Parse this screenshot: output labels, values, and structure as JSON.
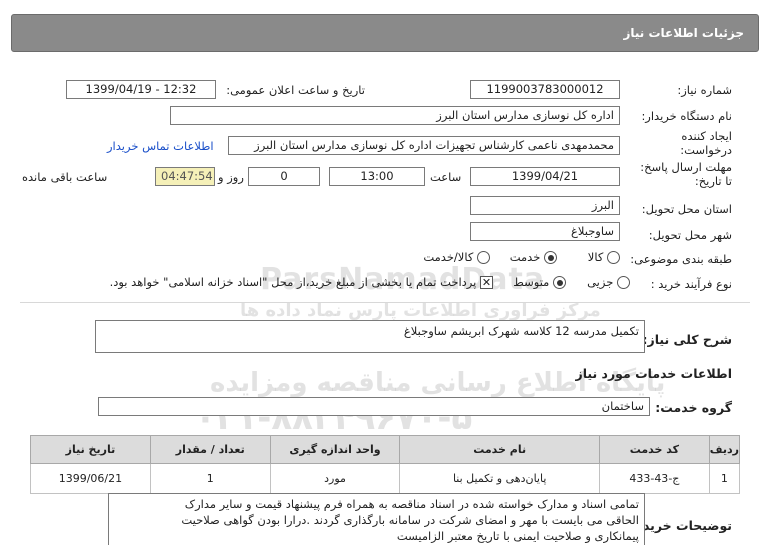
{
  "header": {
    "title": "جزئیات اطلاعات نیاز"
  },
  "fields": {
    "need_number_label": "شماره نیاز:",
    "need_number": "1199003783000012",
    "announce_label": "تاریخ و ساعت اعلان عمومی:",
    "announce_value": "1399/04/19 - 12:32",
    "buyer_label": "نام دستگاه خریدار:",
    "buyer_value": "اداره کل نوسازی مدارس استان البرز",
    "creator_label_1": "ایجاد کننده",
    "creator_label_2": "درخواست:",
    "creator_value": "محمدمهدی ناعمی کارشناس تجهیزات اداره کل نوسازی مدارس استان البرز",
    "contact_link": "اطلاعات تماس خریدار",
    "deadline_label_1": "مهلت ارسال پاسخ:",
    "deadline_label_2": "تا تاریخ:",
    "deadline_date": "1399/04/21",
    "time_label": "ساعت",
    "deadline_time": "13:00",
    "days_value": "0",
    "days_label": "روز و",
    "remaining_value": "04:47:54",
    "remaining_label": "ساعت باقی مانده",
    "province_label": "استان محل تحویل:",
    "province_value": "البرز",
    "city_label": "شهر محل تحویل:",
    "city_value": "ساوجبلاغ",
    "category_label": "طبقه بندی موضوعی:",
    "category_options": [
      "کالا",
      "خدمت",
      "کالا/خدمت"
    ],
    "process_label": "نوع فرآیند خرید :",
    "process_options": [
      "جزیی",
      "متوسط"
    ],
    "payment_note": "پرداخت تمام یا بخشی از مبلغ خرید،از محل \"اسناد خزانه اسلامی\" خواهد بود.",
    "summary_label": "شرح کلی نیاز:",
    "summary_value": "تکمیل مدرسه 12 کلاسه شهرک ابریشم ساوجبلاغ",
    "services_title": "اطلاعات خدمات مورد نیاز",
    "service_group_label": "گروه خدمت:",
    "service_group_value": "ساختمان",
    "notes_label": "توضیحات خریدار:",
    "notes_lines": [
      "تمامی اسناد و مدارک خواسته شده در اسناد مناقصه به همراه فرم پیشنهاد قیمت و سایر مدارک",
      "الحاقی می بایست با مهر و امضای شرکت در سامانه بارگذاری گردند .درارا بودن گواهی صلاحیت",
      "پیمانکاری و صلاحیت ایمنی با تاریخ معتبر الزامیست"
    ]
  },
  "table": {
    "headers": [
      "ردیف",
      "کد خدمت",
      "نام خدمت",
      "واحد اندازه گیری",
      "تعداد / مقدار",
      "تاریخ نیاز"
    ],
    "rows": [
      [
        "1",
        "ج-43-433",
        "پایان‌دهی و تکمیل بنا",
        "مورد",
        "1",
        "1399/06/21"
      ]
    ]
  },
  "watermark": {
    "line1": "ParsNamadData",
    "line2": "مرکز فراوری اطلاعات پارس نماد داده ها",
    "line3": "پایگاه اطلاع رسانی مناقصه ومزایده",
    "line4": "۰۲۱-۸۸۳۴۹۶۷۰-۵"
  },
  "colors": {
    "header_bg": "#8a8a8a",
    "link": "#1a4fc9",
    "remaining_bg": "#f5f0b8"
  }
}
